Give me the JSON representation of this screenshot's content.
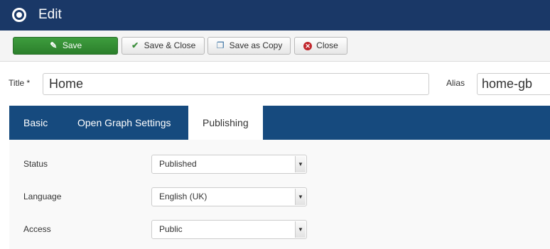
{
  "header": {
    "title": "Edit",
    "icon": "radio-circle-icon",
    "bg_color": "#1a3867"
  },
  "toolbar": {
    "save_label": "Save",
    "save_close_label": "Save & Close",
    "save_copy_label": "Save as Copy",
    "close_label": "Close",
    "save_color": "#3e9d3e",
    "close_icon_color": "#c1272d"
  },
  "form": {
    "title_label": "Title *",
    "title_value": "Home",
    "alias_label": "Alias",
    "alias_value": "home-gb"
  },
  "tabs": [
    {
      "label": "Basic",
      "active": false
    },
    {
      "label": "Open Graph Settings",
      "active": false
    },
    {
      "label": "Publishing",
      "active": true
    }
  ],
  "publishing": {
    "status_label": "Status",
    "status_value": "Published",
    "language_label": "Language",
    "language_value": "English (UK)",
    "access_label": "Access",
    "access_value": "Public"
  },
  "icons": {
    "save": "edit-icon",
    "save_close": "check-icon",
    "save_copy": "copy-icon",
    "close": "close-circle-icon",
    "select_arrow": "chevron-down-icon"
  }
}
